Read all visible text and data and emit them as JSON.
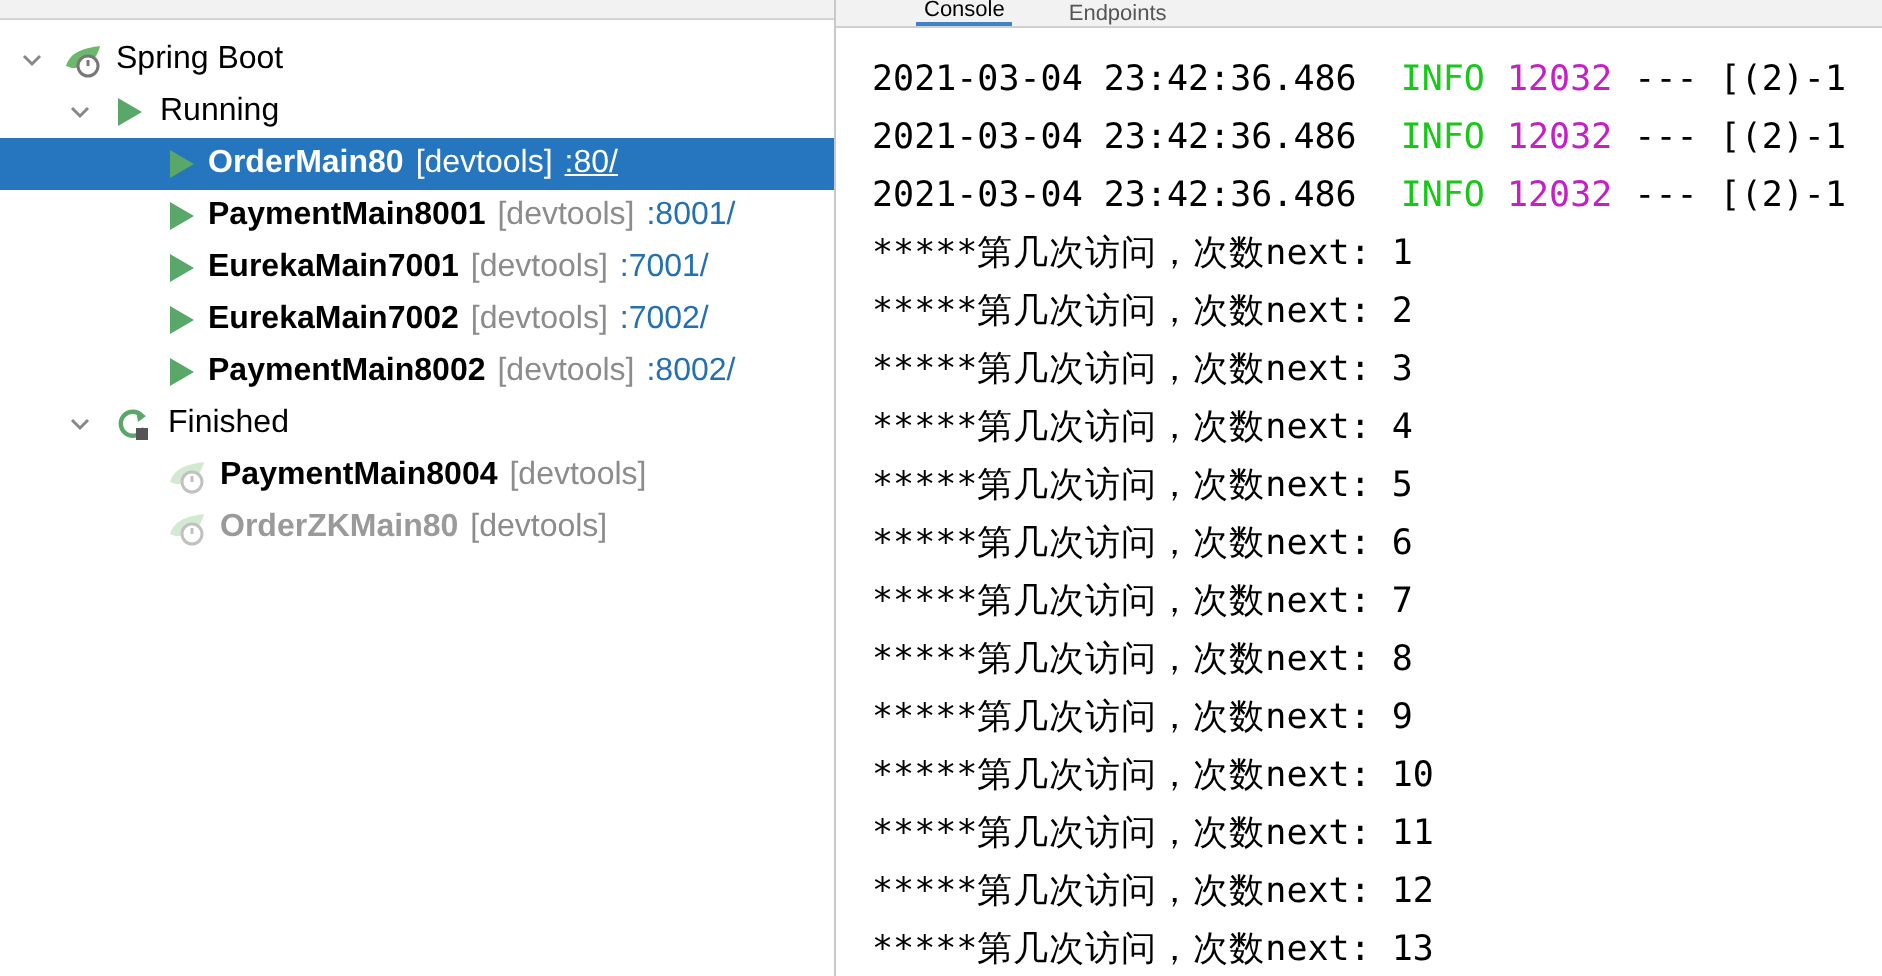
{
  "console_tabs": [
    {
      "label": "Console",
      "selected": true
    },
    {
      "label": "Endpoints",
      "selected": false
    }
  ],
  "tree": [
    {
      "label": "Spring Boot",
      "expanded": true,
      "children": [
        {
          "label": "Running",
          "kind": "running",
          "expanded": true,
          "children": [
            {
              "name": "OrderMain80",
              "tag": "[devtools]",
              "port": ":80/",
              "kind": "app",
              "running": true,
              "selected": true,
              "dimmed": false
            },
            {
              "name": "PaymentMain8001",
              "tag": "[devtools]",
              "port": ":8001/",
              "kind": "app",
              "running": true,
              "selected": false,
              "dimmed": false
            },
            {
              "name": "EurekaMain7001",
              "tag": "[devtools]",
              "port": ":7001/",
              "kind": "app",
              "running": true,
              "selected": false,
              "dimmed": false
            },
            {
              "name": "EurekaMain7002",
              "tag": "[devtools]",
              "port": ":7002/",
              "kind": "app",
              "running": true,
              "selected": false,
              "dimmed": false
            },
            {
              "name": "PaymentMain8002",
              "tag": "[devtools]",
              "port": ":8002/",
              "kind": "app",
              "running": true,
              "selected": false,
              "dimmed": false
            }
          ]
        },
        {
          "label": "Finished",
          "kind": "finished",
          "expanded": true,
          "children": [
            {
              "name": "PaymentMain8004",
              "tag": "[devtools]",
              "kind": "app",
              "running": false,
              "selected": false,
              "dimmed": false
            },
            {
              "name": "OrderZKMain80",
              "tag": "[devtools]",
              "kind": "app",
              "running": false,
              "selected": false,
              "dimmed": true
            }
          ]
        }
      ]
    }
  ],
  "console_lines": [
    {
      "kind": "log",
      "time": "2021-03-04 23:42:36.486",
      "level": "INFO",
      "pid": "12032",
      "sep": "---",
      "thread": "[(2)-1"
    },
    {
      "kind": "log",
      "time": "2021-03-04 23:42:36.486",
      "level": "INFO",
      "pid": "12032",
      "sep": "---",
      "thread": "[(2)-1"
    },
    {
      "kind": "log",
      "time": "2021-03-04 23:42:36.486",
      "level": "INFO",
      "pid": "12032",
      "sep": "---",
      "thread": "[(2)-1"
    },
    {
      "kind": "output",
      "text": "*****第几次访问，次数next: 1"
    },
    {
      "kind": "output",
      "text": "*****第几次访问，次数next: 2"
    },
    {
      "kind": "output",
      "text": "*****第几次访问，次数next: 3"
    },
    {
      "kind": "output",
      "text": "*****第几次访问，次数next: 4"
    },
    {
      "kind": "output",
      "text": "*****第几次访问，次数next: 5"
    },
    {
      "kind": "output",
      "text": "*****第几次访问，次数next: 6"
    },
    {
      "kind": "output",
      "text": "*****第几次访问，次数next: 7"
    },
    {
      "kind": "output",
      "text": "*****第几次访问，次数next: 8"
    },
    {
      "kind": "output",
      "text": "*****第几次访问，次数next: 9"
    },
    {
      "kind": "output",
      "text": "*****第几次访问，次数next: 10"
    },
    {
      "kind": "output",
      "text": "*****第几次访问，次数next: 11"
    },
    {
      "kind": "output",
      "text": "*****第几次访问，次数next: 12"
    },
    {
      "kind": "output",
      "text": "*****第几次访问，次数next: 13"
    }
  ]
}
